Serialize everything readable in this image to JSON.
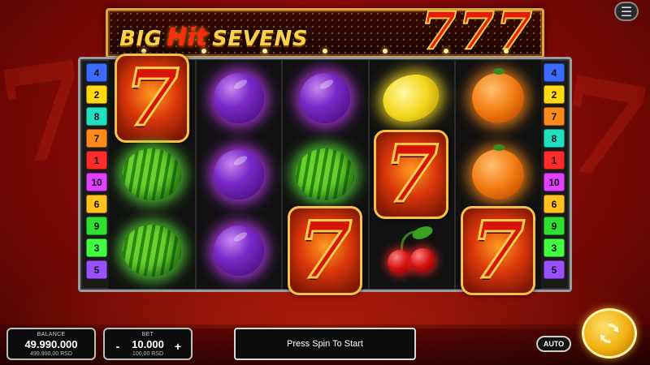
{
  "title": {
    "big": "BIG",
    "hit": "Hit",
    "sevens": "SEVENS",
    "logo_sevens": [
      "7",
      "7",
      "7"
    ]
  },
  "menu": {
    "icon": "hamburger-menu-icon",
    "glyph": "☰"
  },
  "paylines": {
    "left": [
      {
        "num": "4",
        "color": "#3a6aff"
      },
      {
        "num": "2",
        "color": "#ffd814"
      },
      {
        "num": "8",
        "color": "#20e0c0"
      },
      {
        "num": "7",
        "color": "#ff8a1a"
      },
      {
        "num": "1",
        "color": "#ff2a2a"
      },
      {
        "num": "10",
        "color": "#e040ff"
      },
      {
        "num": "6",
        "color": "#ffc020"
      },
      {
        "num": "9",
        "color": "#30e030"
      },
      {
        "num": "3",
        "color": "#40ff40"
      },
      {
        "num": "5",
        "color": "#9a50ff"
      }
    ],
    "right": [
      {
        "num": "4",
        "color": "#3a6aff"
      },
      {
        "num": "2",
        "color": "#ffd814"
      },
      {
        "num": "7",
        "color": "#ff8a1a"
      },
      {
        "num": "8",
        "color": "#20e0c0"
      },
      {
        "num": "1",
        "color": "#ff2a2a"
      },
      {
        "num": "10",
        "color": "#e040ff"
      },
      {
        "num": "6",
        "color": "#ffc020"
      },
      {
        "num": "9",
        "color": "#30e030"
      },
      {
        "num": "3",
        "color": "#40ff40"
      },
      {
        "num": "5",
        "color": "#9a50ff"
      }
    ]
  },
  "reels": [
    [
      "seven",
      "plum",
      "plum",
      "lemon",
      "orange"
    ],
    [
      "melon",
      "plum",
      "melon",
      "seven",
      "orange"
    ],
    [
      "melon",
      "plum",
      "seven",
      "cherry",
      "seven"
    ]
  ],
  "seven_glyph": "7",
  "balance": {
    "label": "BALANCE",
    "value": "49.990.000",
    "sub": "499.900,00 RSD"
  },
  "bet": {
    "label": "BET",
    "value": "10.000",
    "sub": "100,00 RSD",
    "minus": "-",
    "plus": "+"
  },
  "message": "Press Spin To Start",
  "auto": "AUTO",
  "spin": {
    "icon": "spin-arrows-icon"
  }
}
